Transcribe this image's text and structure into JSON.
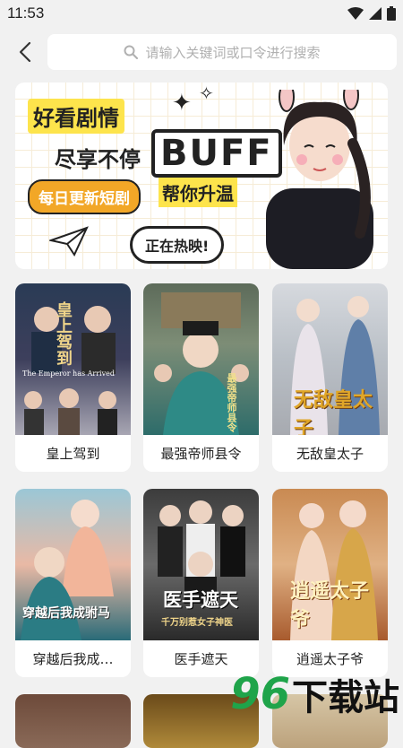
{
  "status": {
    "time": "11:53"
  },
  "search": {
    "placeholder": "请输入关键词或口令进行搜索"
  },
  "banner": {
    "line1": "好看剧情",
    "line2": "尽享不停",
    "buff": "BUFF",
    "tag": "每日更新短剧",
    "line3": "帮你升温",
    "bubble": "正在热映!"
  },
  "dramas": [
    {
      "title": "皇上驾到",
      "poster_text": "皇上驾到",
      "poster_sub": "The Emperor has Arrived"
    },
    {
      "title": "最强帝师县令",
      "poster_text": "最强帝师县令"
    },
    {
      "title": "无敌皇太子",
      "poster_text": "无敌皇太子"
    },
    {
      "title": "穿越后我成…",
      "poster_text": "穿越后我成驸马"
    },
    {
      "title": "医手遮天",
      "poster_text": "医手遮天",
      "poster_sub": "千万别惹女子神医"
    },
    {
      "title": "逍遥太子爷",
      "poster_text": "逍遥太子爷"
    }
  ],
  "watermark": {
    "number": "96",
    "text": "下载站"
  },
  "colors": {
    "accent_yellow": "#fde44c",
    "tag_orange": "#f2a727",
    "watermark_green": "#1fa44a"
  }
}
